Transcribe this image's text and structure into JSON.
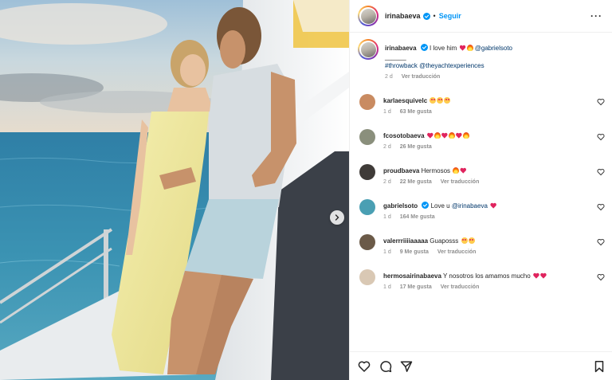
{
  "post": {
    "author": "irinabaeva",
    "follow_label": "Seguir",
    "separator": "•",
    "more_label": "···",
    "caption": {
      "username": "irinabaeva",
      "text": "I love him",
      "mention": "@gabrielsoto",
      "divider": "______",
      "hashtags": "#throwback @theyachtexperiences",
      "time": "2 d",
      "translate": "Ver traducción"
    }
  },
  "comments": [
    {
      "username": "karlaesquivelc",
      "text": "",
      "emojis": [
        "face",
        "face",
        "face"
      ],
      "time": "1 d",
      "likes": "63 Me gusta",
      "translate": "",
      "avatar_color": "#c98b61",
      "verified": false
    },
    {
      "username": "fcosotobaeva",
      "text": "",
      "emojis": [
        "heart",
        "fire",
        "heart",
        "fire",
        "heart",
        "fire"
      ],
      "time": "2 d",
      "likes": "26 Me gusta",
      "translate": "",
      "avatar_color": "#8a8f7c",
      "verified": false
    },
    {
      "username": "proudbaeva",
      "text": "Hermosos",
      "emojis": [
        "fire",
        "heart"
      ],
      "time": "2 d",
      "likes": "22 Me gusta",
      "translate": "Ver traducción",
      "avatar_color": "#3f3b38",
      "verified": false
    },
    {
      "username": "gabrielsoto",
      "text": "Love u",
      "mention": "@irinabaeva",
      "emojis": [
        "heart"
      ],
      "time": "1 d",
      "likes": "164 Me gusta",
      "translate": "",
      "avatar_color": "#4a9fb3",
      "verified": true
    },
    {
      "username": "valerrriiiiaaaaa",
      "text": "Guaposss",
      "emojis": [
        "face",
        "face"
      ],
      "time": "1 d",
      "likes": "9 Me gusta",
      "translate": "Ver traducción",
      "avatar_color": "#6b5a48",
      "verified": false
    },
    {
      "username": "hermosairinabaeva",
      "text": "Y nosotros los amamos mucho",
      "emojis": [
        "heart",
        "heart"
      ],
      "time": "1 d",
      "likes": "17 Me gusta",
      "translate": "Ver traducción",
      "avatar_color": "#d9c8b4",
      "verified": false
    }
  ],
  "colors": {
    "accent": "#0095f6",
    "verified": "#0095f6",
    "meta": "#8e8e8e",
    "heart_emoji": "#e0245e"
  },
  "icons": {
    "next": "chevron-right-icon",
    "like": "heart-icon",
    "comment": "comment-icon",
    "share": "share-icon",
    "save": "bookmark-icon",
    "more": "more-icon"
  }
}
